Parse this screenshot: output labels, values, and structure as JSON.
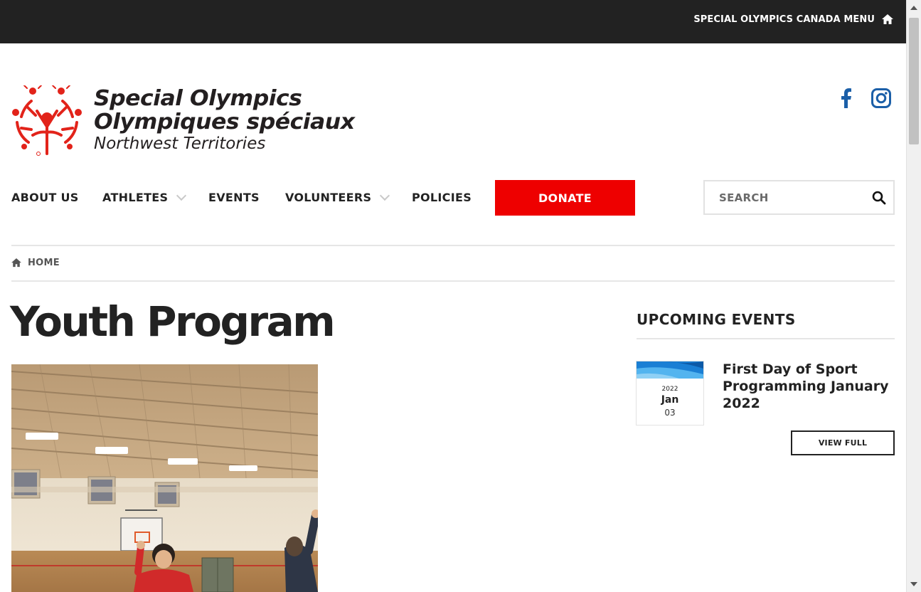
{
  "topbar": {
    "canada_menu_label": "SPECIAL OLYMPICS CANADA MENU",
    "icon": "home-icon",
    "background": "#222222"
  },
  "logo": {
    "line1": "Special Olympics",
    "line2": "Olympiques spéciaux",
    "line3": "Northwest Territories",
    "mark_color": "#e2231a"
  },
  "social": [
    {
      "name": "facebook-icon",
      "color": "#1b5fa8"
    },
    {
      "name": "instagram-icon",
      "color": "#1b5fa8"
    }
  ],
  "nav": {
    "items": [
      {
        "label": "ABOUT US",
        "has_dropdown": false
      },
      {
        "label": "ATHLETES",
        "has_dropdown": true
      },
      {
        "label": "EVENTS",
        "has_dropdown": false
      },
      {
        "label": "VOLUNTEERS",
        "has_dropdown": true
      },
      {
        "label": "POLICIES",
        "has_dropdown": false
      }
    ],
    "donate_label": "DONATE",
    "donate_color": "#ee0000",
    "search_placeholder": "SEARCH"
  },
  "breadcrumb": {
    "home_label": "HOME"
  },
  "main": {
    "title": "Youth Program"
  },
  "sidebar": {
    "heading": "UPCOMING EVENTS",
    "event": {
      "year": "2022",
      "month": "Jan",
      "day": "03",
      "title": "First Day of Sport Programming January 2022",
      "button_label": "VIEW FULL"
    }
  }
}
